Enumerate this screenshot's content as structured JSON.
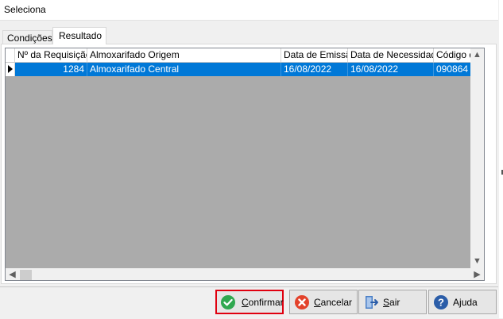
{
  "window": {
    "title": "Seleciona"
  },
  "tabs": [
    {
      "label": "Condições",
      "active": false
    },
    {
      "label": "Resultado",
      "active": true
    }
  ],
  "grid": {
    "columns": [
      "Nº  da Requisição",
      "Almoxarifado Origem",
      "Data de Emissão",
      "Data de Necessidade",
      "Código do It"
    ],
    "rows": [
      [
        "1284",
        "Almoxarifado Central",
        "16/08/2022",
        "16/08/2022",
        "090864"
      ]
    ],
    "selected_row": 0
  },
  "buttons": {
    "confirm": {
      "pre": "",
      "key": "C",
      "post": "onfirmar",
      "icon": "check-circle-icon"
    },
    "cancel": {
      "pre": "",
      "key": "C",
      "post": "ancelar",
      "icon": "x-circle-icon"
    },
    "exit": {
      "pre": "",
      "key": "S",
      "post": "air",
      "icon": "exit-door-icon"
    },
    "help": {
      "pre": "A",
      "key": "j",
      "post": "uda",
      "icon": "help-icon"
    }
  },
  "colors": {
    "selection": "#0078d7",
    "highlight_border": "#e0000f",
    "confirm_icon": "#2fa84f",
    "cancel_icon": "#e3422b",
    "help_icon": "#2b5da8",
    "exit_icon": "#4a7fc6"
  }
}
